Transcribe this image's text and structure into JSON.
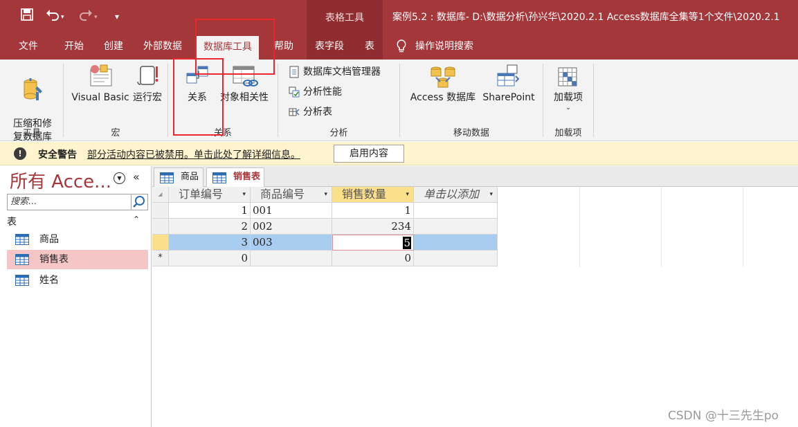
{
  "titlebar": {
    "context_tab": "表格工具",
    "title": "案例5.2 : 数据库- D:\\数据分析\\孙兴华\\2020.2.1 Access数据库全集等1个文件\\2020.2.1"
  },
  "tabs": [
    {
      "label": "文件",
      "x": 0
    },
    {
      "label": "开始"
    },
    {
      "label": "创建"
    },
    {
      "label": "外部数据"
    },
    {
      "label": "数据库工具"
    },
    {
      "label": "帮助"
    },
    {
      "label": "表字段"
    },
    {
      "label": "表"
    }
  ],
  "tell_me": "操作说明搜索",
  "ribbon": {
    "tools": {
      "label": "工具",
      "compact_repair": "压缩和修\n复数据库"
    },
    "macro": {
      "label": "宏",
      "visual_basic": "Visual Basic",
      "run_macro": "运行宏"
    },
    "relationships": {
      "label": "关系",
      "relationships_btn": "关系",
      "object_dependencies": "对象相关性"
    },
    "analyze": {
      "label": "分析",
      "documenter": "数据库文档管理器",
      "analyze_performance": "分析性能",
      "analyze_table": "分析表"
    },
    "move_data": {
      "label": "移动数据",
      "access_db": "Access 数据库",
      "sharepoint": "SharePoint"
    },
    "addins": {
      "label": "加载项",
      "addins_btn": "加载项"
    }
  },
  "security": {
    "title": "安全警告",
    "message": "部分活动内容已被禁用。单击此处了解详细信息。",
    "enable_button": "启用内容"
  },
  "nav": {
    "title": "所有 Acce...",
    "search_placeholder": "搜索...",
    "section": "表",
    "items": [
      "商品",
      "销售表",
      "姓名"
    ]
  },
  "doc_tabs": [
    "商品",
    "销售表"
  ],
  "grid": {
    "headers": [
      "订单编号",
      "商品编号",
      "销售数量",
      "单击以添加"
    ],
    "rows": [
      {
        "selector": "",
        "order_id": "1",
        "product_id": "001",
        "qty": "1"
      },
      {
        "selector": "",
        "order_id": "2",
        "product_id": "002",
        "qty": "234"
      },
      {
        "selector": "",
        "order_id": "3",
        "product_id": "003",
        "qty": "5"
      },
      {
        "selector": "*",
        "order_id": "0",
        "product_id": "",
        "qty": "0"
      }
    ]
  },
  "watermark": "CSDN @十三先生po",
  "colors": {
    "accent": "#a4373a",
    "warning_bar": "#fff4ce",
    "row_highlight": "#a9cdf0",
    "annotation": "#e8262c"
  }
}
